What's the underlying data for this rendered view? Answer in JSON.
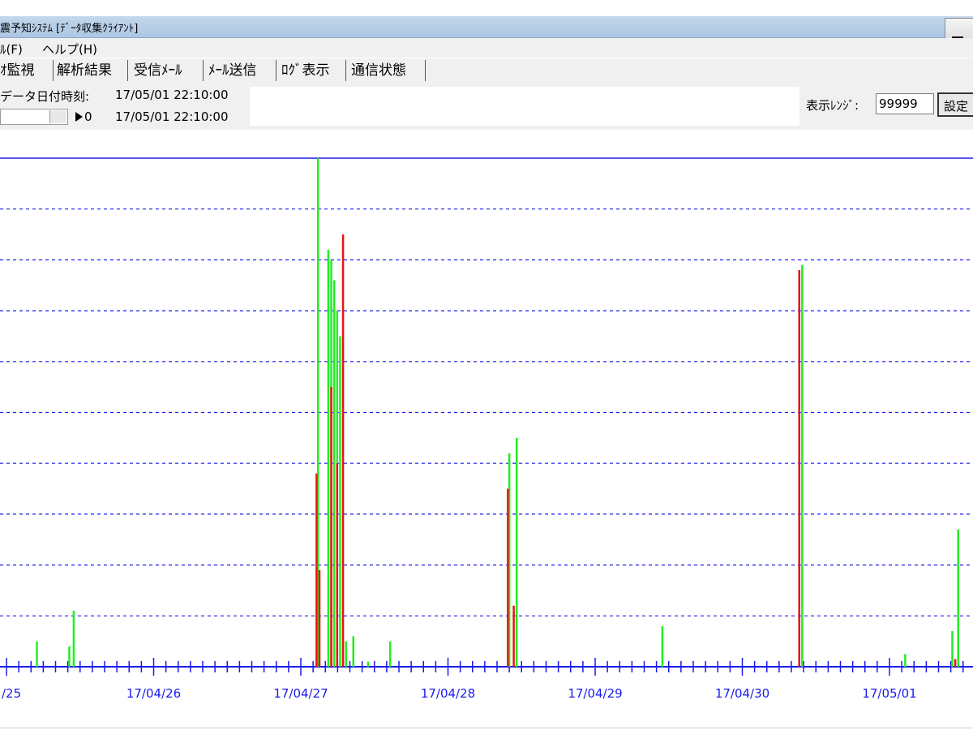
{
  "window": {
    "title": "震予知ｼｽﾃﾑ [ﾃﾞｰﾀ収集ｸﾗｲｱﾝﾄ]"
  },
  "menu": [
    "ﾙ(F)",
    "ヘルプ(H)"
  ],
  "tabs": [
    "ｵ監視",
    "解析結果",
    "受信ﾒｰﾙ",
    "ﾒｰﾙ送信",
    "ﾛｸﾞ表示",
    "通信状態"
  ],
  "info": {
    "date_label": "データ日付時刻:",
    "date_value_1": "17/05/01  22:10:00",
    "slider_value": "0",
    "date_value_2": "17/05/01  22:10:00",
    "range_label": "表示ﾚﾝｼﾞ:",
    "range_value": "99999",
    "set_button": "設定"
  },
  "colors": {
    "series_green": "#22ee22",
    "series_red": "#ee1111",
    "series_dark": "#8a5a00",
    "axis": "#1a1aee"
  },
  "chart_data": {
    "type": "bar",
    "x_tick_labels": [
      "/25",
      "17/04/26",
      "17/04/27",
      "17/04/28",
      "17/04/29",
      "17/04/30",
      "17/05/01"
    ],
    "grid": "horizontal dashed",
    "gridline_count": 10,
    "y_range": [
      0,
      10
    ],
    "series": [
      {
        "color": "green",
        "points": [
          [
            0.2,
            0.5
          ],
          [
            0.42,
            0.4
          ],
          [
            0.45,
            1.1
          ],
          [
            2.11,
            10.0
          ],
          [
            2.18,
            8.2
          ],
          [
            2.2,
            8.0
          ],
          [
            2.22,
            7.6
          ],
          [
            2.24,
            7.0
          ],
          [
            2.26,
            6.5
          ],
          [
            2.3,
            0.5
          ],
          [
            2.35,
            0.6
          ],
          [
            2.45,
            0.1
          ],
          [
            2.6,
            0.5
          ],
          [
            3.41,
            4.2
          ],
          [
            3.46,
            4.5
          ],
          [
            4.45,
            0.8
          ],
          [
            5.4,
            7.9
          ],
          [
            6.1,
            0.25
          ],
          [
            6.42,
            0.7
          ],
          [
            6.46,
            2.7
          ]
        ]
      },
      {
        "color": "red",
        "points": [
          [
            2.1,
            3.8
          ],
          [
            2.12,
            1.9
          ],
          [
            2.2,
            5.5
          ],
          [
            2.24,
            4.0
          ],
          [
            2.28,
            8.5
          ],
          [
            3.4,
            3.5
          ],
          [
            3.44,
            1.2
          ],
          [
            5.38,
            7.8
          ],
          [
            6.44,
            0.15
          ]
        ]
      }
    ]
  }
}
